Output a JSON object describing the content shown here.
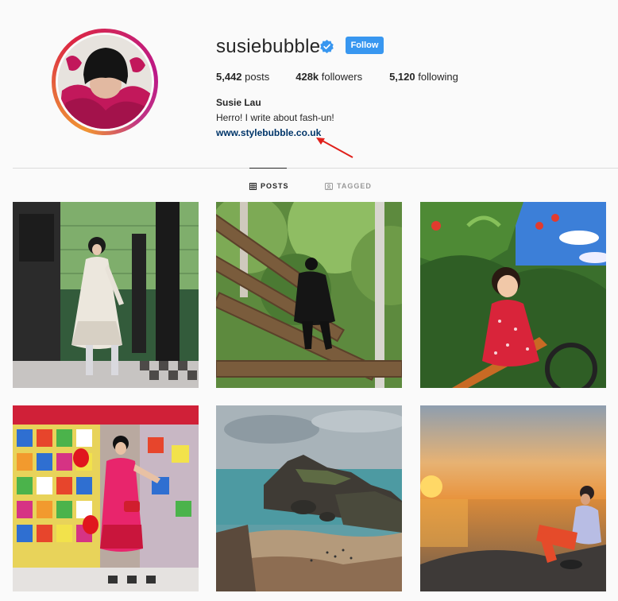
{
  "profile": {
    "username": "susiebubble",
    "verified": true,
    "follow_label": "Follow",
    "posts_count": "5,442",
    "posts_label": " posts",
    "followers_count": "428k",
    "followers_label": " followers",
    "following_count": "5,120",
    "following_label": " following",
    "full_name": "Susie Lau",
    "bio": "Herro! I write about fash-un!",
    "website": "www.stylebubble.co.uk"
  },
  "tabs": [
    {
      "label": "POSTS",
      "icon": "grid-icon",
      "active": true
    },
    {
      "label": "TAGGED",
      "icon": "tag-icon",
      "active": false
    }
  ],
  "posts": [
    {
      "subject": "woman in lace dress against green tiled wall"
    },
    {
      "subject": "person in black coat on wooden logs in forest"
    },
    {
      "subject": "toddler in red dress in garden"
    },
    {
      "subject": "woman in red fringe dress in toy shop"
    },
    {
      "subject": "coastal cove with rocks and beach"
    },
    {
      "subject": "woman sitting on rocks at sunset by the sea"
    }
  ],
  "colors": {
    "accent": "#3897f0",
    "link": "#003569",
    "annotation_arrow": "#e0201b",
    "divider": "#dbdbdb",
    "muted": "#999999"
  }
}
